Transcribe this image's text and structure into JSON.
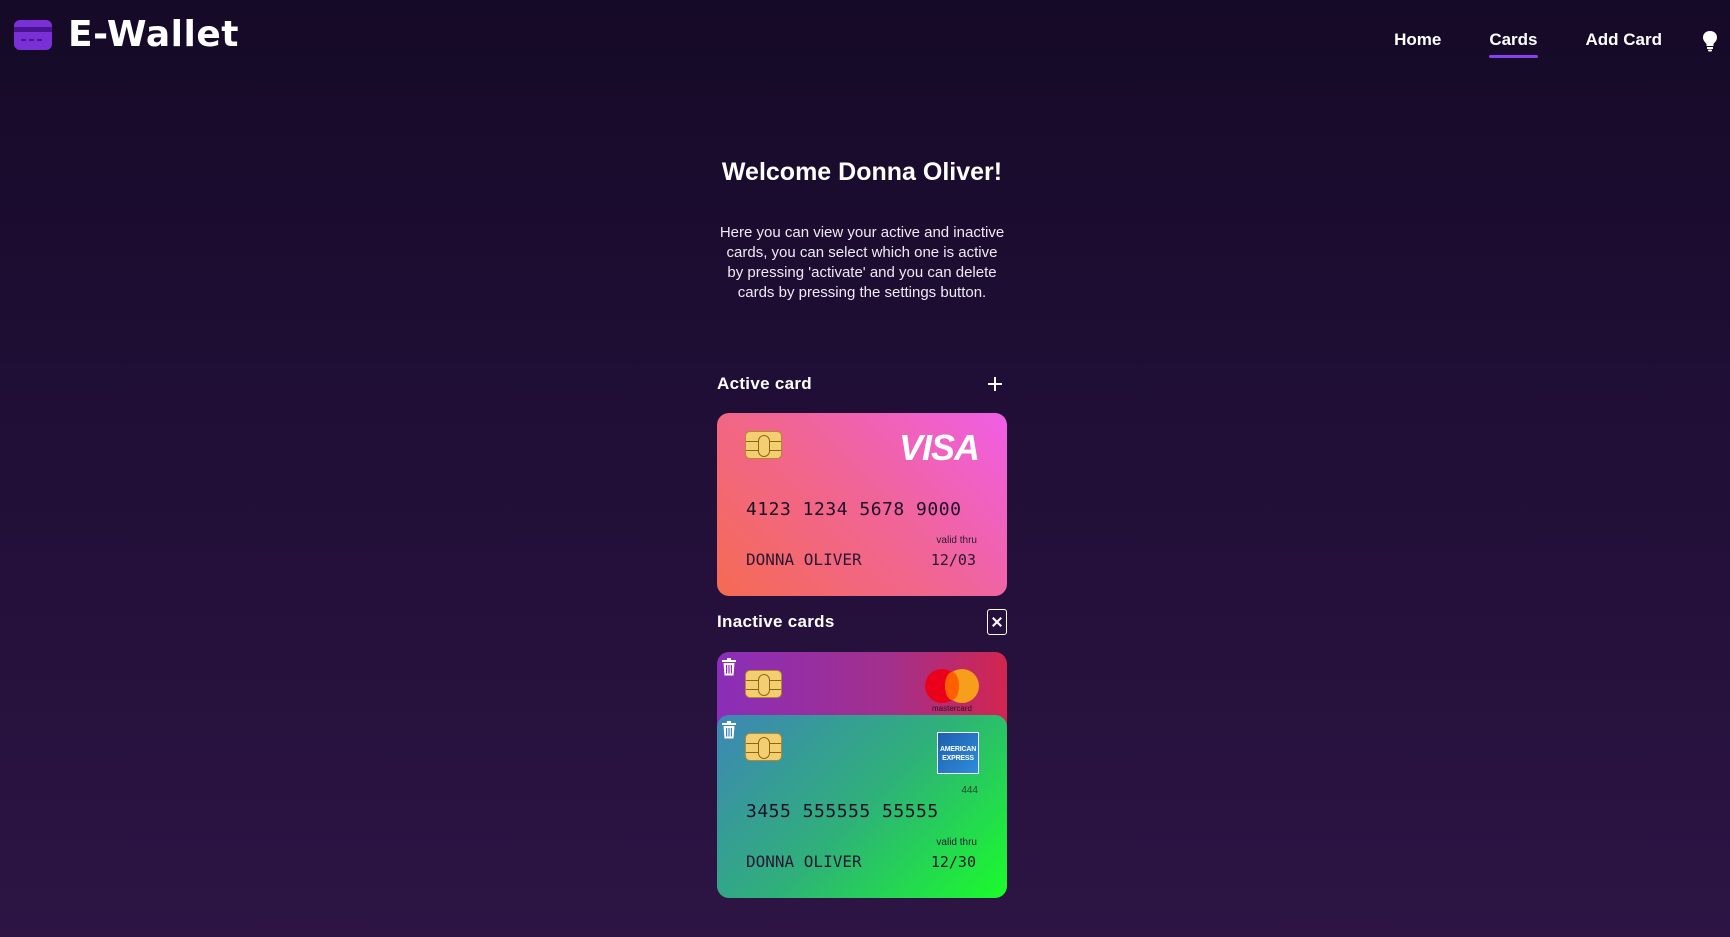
{
  "app": {
    "title": "E-Wallet"
  },
  "nav": {
    "items": [
      {
        "label": "Home"
      },
      {
        "label": "Cards"
      },
      {
        "label": "Add Card"
      }
    ],
    "active": "Cards"
  },
  "main": {
    "welcome": "Welcome Donna Oliver!",
    "description": "Here you can view your active and inactive cards, you can select which one is active by pressing 'activate' and you can delete cards by pressing the settings button."
  },
  "active_section": {
    "title": "Active card"
  },
  "inactive_section": {
    "title": "Inactive cards"
  },
  "cards": {
    "active": {
      "brand": "VISA",
      "number": "4123 1234 5678 9000",
      "holder": "DONNA OLIVER",
      "valid_label": "valid thru",
      "valid": "12/03"
    },
    "inactive": [
      {
        "brand": "mastercard"
      },
      {
        "brand": "AMERICAN EXPRESS",
        "brand_line1": "AMERICAN",
        "brand_line2": "EXPRESS",
        "cvv": "444",
        "number": "3455 555555 55555",
        "holder": "DONNA OLIVER",
        "valid_label": "valid thru",
        "valid": "12/30"
      }
    ]
  },
  "colors": {
    "accent": "#8a3ef2",
    "background_top": "#150a27",
    "background_bottom": "#2d1444"
  },
  "icons": [
    "credit-card-icon",
    "lightbulb-icon",
    "plus-icon",
    "close-icon",
    "trash-icon",
    "chip-icon"
  ]
}
